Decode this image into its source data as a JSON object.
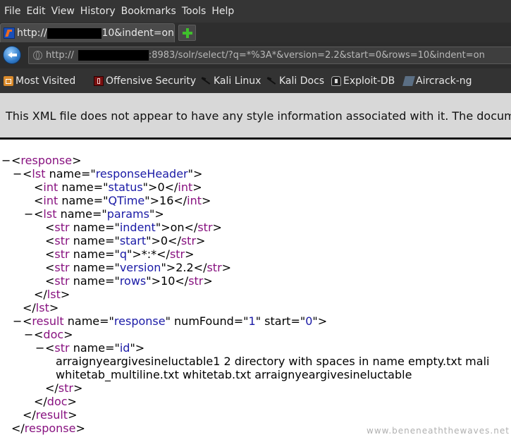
{
  "menu": [
    "File",
    "Edit",
    "View",
    "History",
    "Bookmarks",
    "Tools",
    "Help"
  ],
  "tab": {
    "prefix": "http://",
    "suffix": "10&indent=on"
  },
  "url": {
    "prefix": "http://",
    "suffix": ":8983/solr/select/?q=*%3A*&version=2.2&start=0&rows=10&indent=on"
  },
  "bookmarks": [
    "Most Visited",
    "Offensive Security",
    "Kali Linux",
    "Kali Docs",
    "Exploit-DB",
    "Aircrack-ng"
  ],
  "notice": "This XML file does not appear to have any style information associated with it. The document tree is shown below.",
  "xml": {
    "toggle": "−",
    "response_tag": "response",
    "lst_tag": "lst",
    "int_tag": "int",
    "str_tag": "str",
    "result_tag": "result",
    "doc_tag": "doc",
    "name_attr": "name",
    "numfound_attr": "numFound",
    "start_attr": "start",
    "response_header": "responseHeader",
    "status_name": "status",
    "status_value": "0",
    "qtime_name": "QTime",
    "qtime_value": "16",
    "params_name": "params",
    "indent_name": "indent",
    "indent_value": "on",
    "start_name": "start",
    "start_value": "0",
    "q_name": "q",
    "q_value": "*:*",
    "version_name": "version",
    "version_value": "2.2",
    "rows_name": "rows",
    "rows_value": "10",
    "result_name": "response",
    "num_found": "1",
    "result_start": "0",
    "id_name": "id",
    "id_line1": "arraignyeargivesineluctable1 2 directory with spaces in name empty.txt mali",
    "id_line2": "whitetab_multiline.txt whitetab.txt arraignyeargivesineluctable"
  },
  "watermark": "www.beneneaththewaves.net"
}
